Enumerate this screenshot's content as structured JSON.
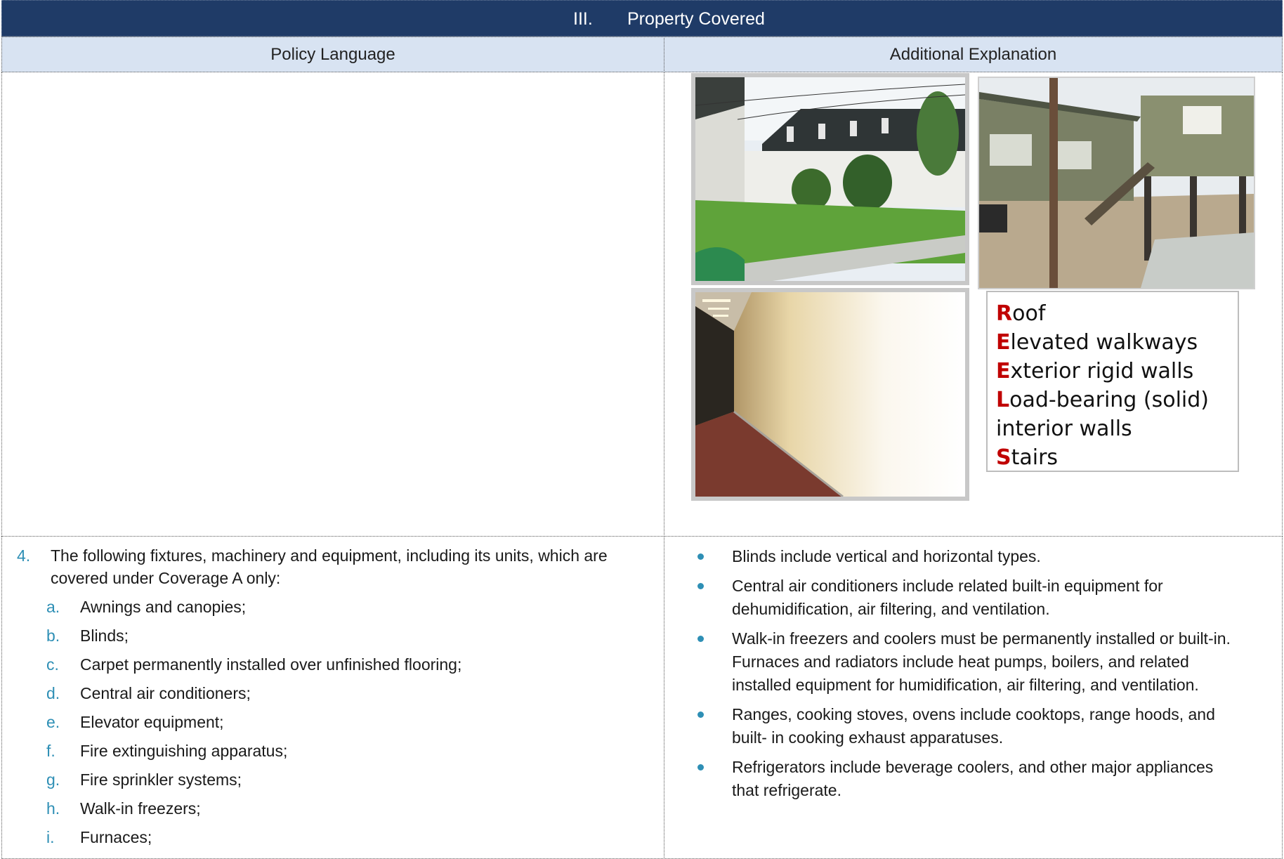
{
  "header": {
    "section_number": "III.",
    "section_title": "Property Covered"
  },
  "columns": {
    "left": "Policy Language",
    "right": "Additional Explanation"
  },
  "reels_box": {
    "lines": [
      {
        "cap": "R",
        "rest": "oof"
      },
      {
        "cap": "E",
        "rest": "levated walkways"
      },
      {
        "cap": "E",
        "rest": "xterior rigid walls"
      },
      {
        "cap": "L",
        "rest": "oad-bearing (solid)"
      },
      {
        "cap": "",
        "rest": "interior walls"
      },
      {
        "cap": "S",
        "rest": "tairs"
      }
    ]
  },
  "policy": {
    "item_number": "4.",
    "item_text": "The following fixtures, machinery and equipment, including its units, which are covered under Coverage A only:",
    "subitems": [
      {
        "letter": "a.",
        "text": "Awnings and canopies;"
      },
      {
        "letter": "b.",
        "text": "Blinds;"
      },
      {
        "letter": "c.",
        "text": "Carpet permanently installed over unfinished flooring;"
      },
      {
        "letter": "d.",
        "text": "Central air conditioners;"
      },
      {
        "letter": "e.",
        "text": "Elevator equipment;"
      },
      {
        "letter": "f.",
        "text": "Fire extinguishing apparatus;"
      },
      {
        "letter": "g.",
        "text": "Fire sprinkler systems;"
      },
      {
        "letter": "h.",
        "text": "Walk-in freezers;"
      },
      {
        "letter": "i.",
        "text": "Furnaces;"
      }
    ]
  },
  "explanation": {
    "bullets": [
      "Blinds include vertical and horizontal types.",
      "Central air conditioners include related built-in equipment for dehumidification, air filtering, and ventilation.",
      "Walk-in freezers and coolers must be permanently installed or built-in. Furnaces and radiators include heat pumps, boilers, and related installed equipment for humidification, air filtering, and ventilation.",
      "Ranges, cooking stoves, ovens include cooktops, range hoods, and built- in cooking exhaust apparatuses.",
      "Refrigerators include beverage coolers, and other major appliances that refrigerate."
    ]
  },
  "colors": {
    "header_bg": "#1f3b67",
    "column_header_bg": "#d8e3f2",
    "accent": "#2e8fb5",
    "reels_capital": "#c00000"
  }
}
